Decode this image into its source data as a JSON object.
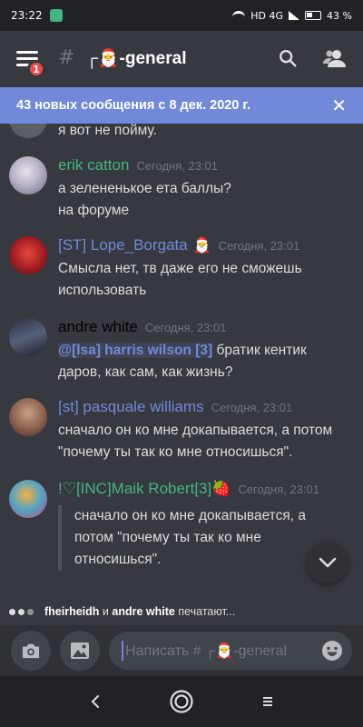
{
  "status_bar": {
    "time": "23:22",
    "network": "HD 4G",
    "battery": "43 %"
  },
  "header": {
    "channel_name": "┌🎅-general",
    "notification_count": "1"
  },
  "banner": {
    "text": "43 новых сообщения с 8 дек. 2020 г."
  },
  "messages": [
    {
      "lines": [
        "я вот не пойму."
      ]
    },
    {
      "author": "erik catton",
      "author_color": "#43b581",
      "timestamp": "Сегодня, 23:01",
      "lines": [
        "а зелененькое ета баллы?",
        "на форуме"
      ]
    },
    {
      "author": "[ST] Lope_Borgata",
      "author_emoji": "🎅",
      "author_color": "#7289da",
      "timestamp": "Сегодня, 23:01",
      "lines": [
        "Смысла нет, тв даже его не сможешь",
        "использовать"
      ]
    },
    {
      "author": "andre white",
      "author_color": "#000000",
      "timestamp": "Сегодня, 23:01",
      "mention": "@[lsa] harris wilson [3]",
      "lines": [
        " братик кентик",
        "даров, как сам, как жизнь?"
      ]
    },
    {
      "author": "[st] pasquale williams",
      "author_color": "#7289da",
      "timestamp": "Сегодня, 23:01",
      "lines": [
        "сначало он ко мне докапывается, а потом",
        "\"почему ты так ко мне относишься\"."
      ]
    },
    {
      "author": "!♡[INC]Maik Robert[3]🍓",
      "author_color": "#43b581",
      "timestamp": "Сегодня, 23:01",
      "lines": [
        "сначало он ко мне докапывается, а",
        "потом \"почему ты так ко мне",
        "относишься\"."
      ]
    }
  ],
  "typing": {
    "user1": "fheirheidh",
    "joiner": "и",
    "user2": "andre white",
    "suffix": "печатают..."
  },
  "composer": {
    "placeholder": "Написать # ┌🎅-general"
  },
  "colors": {
    "accent": "#7289da",
    "background": "#36393f",
    "green_role": "#43b581"
  }
}
